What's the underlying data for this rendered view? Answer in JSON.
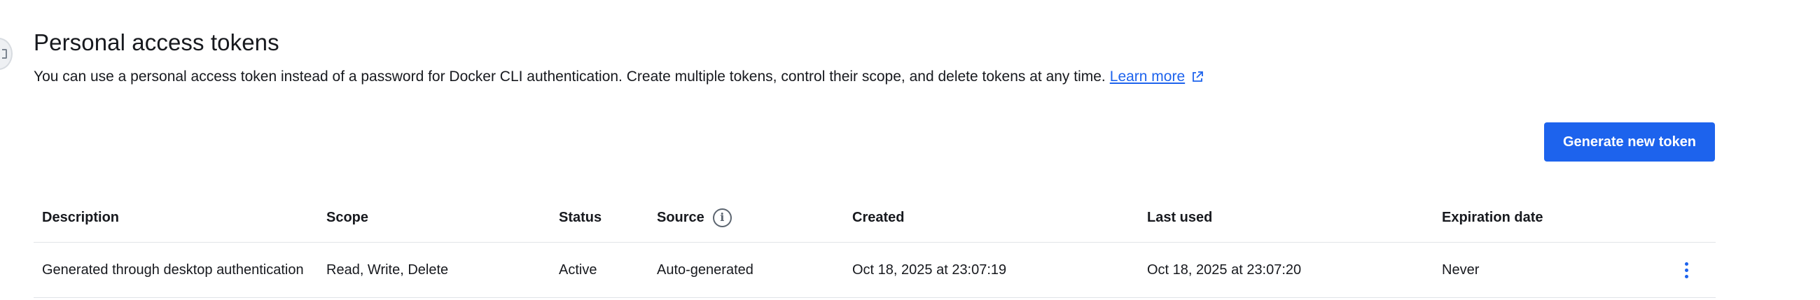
{
  "header": {
    "title": "Personal access tokens",
    "description": "You can use a personal access token instead of a password for Docker CLI authentication. Create multiple tokens, control their scope, and delete tokens at any time.",
    "learn_more": "Learn more"
  },
  "actions": {
    "generate_label": "Generate new token"
  },
  "colors": {
    "accent": "#1d63ed",
    "text": "#17191e",
    "divider": "#e1e4e8"
  },
  "table": {
    "columns": {
      "description": "Description",
      "scope": "Scope",
      "status": "Status",
      "source": "Source",
      "created": "Created",
      "last_used": "Last used",
      "expiration": "Expiration date"
    },
    "rows": [
      {
        "description": "Generated through desktop authentication",
        "scope": "Read, Write, Delete",
        "status": "Active",
        "source": "Auto-generated",
        "created": "Oct 18, 2025 at 23:07:19",
        "last_used": "Oct 18, 2025 at 23:07:20",
        "expiration": "Never"
      }
    ]
  },
  "icons": {
    "source_info": "info-icon",
    "external_link": "external-link-icon",
    "row_menu": "more-vertical-icon"
  }
}
